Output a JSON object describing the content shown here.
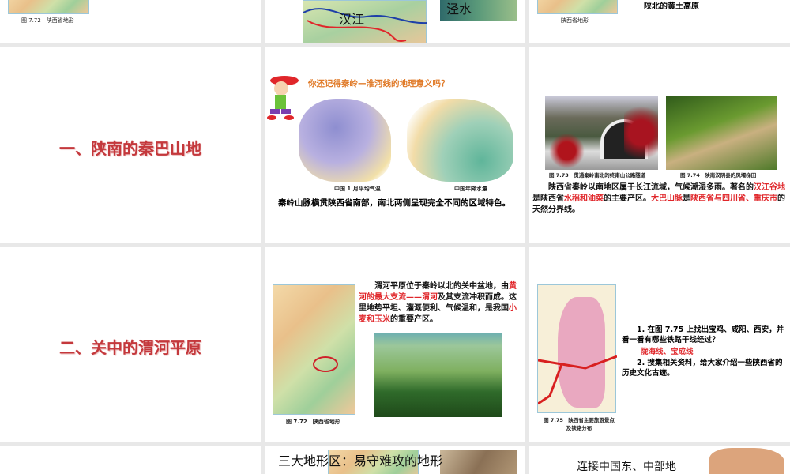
{
  "slides": {
    "s1": {
      "caption": "图 7.72　陕西省地形"
    },
    "s2": {
      "map_label": "汉江",
      "photo_label": "泾水"
    },
    "s3": {
      "caption": "陕西省地形",
      "text": "陕北的黄土高原"
    },
    "s4": {
      "title": "一、陕南的秦巴山地"
    },
    "s5": {
      "question": "你还记得秦岭—淮河线的地理意义吗？",
      "map1_caption": "中国 1 月平均气温",
      "map2_caption": "中国年降水量",
      "sentence": "秦岭山脉横贯陕西省南部，南北两侧呈现完全不同的区域特色。"
    },
    "s6": {
      "photo1_caption": "图 7.73　贯通秦岭南北的终南山公路隧道",
      "photo2_caption": "图 7.74　陕南汉阴县的凤堰梯田",
      "p": [
        "陕西省秦岭以南地区属于长江流域，气候潮湿多雨。著名的",
        "汉江谷地",
        "是陕西省",
        "水稻和油菜",
        "的主要产区。",
        "大巴山脉",
        "是",
        "陕西省与四川省、重庆市",
        "的天然分界线。"
      ]
    },
    "s7": {
      "title": "二、关中的渭河平原"
    },
    "s8": {
      "caption": "图 7.72　陕西省地形",
      "p": [
        "渭河平原位于秦岭以北的关中盆地，由",
        "黄河的最大支流——渭河",
        "及其支流冲积而成。这里地势平坦、灌溉便利、气候温和，是我国",
        "小麦和玉米",
        "的重要产区。"
      ]
    },
    "s9": {
      "caption": "图 7.75　陕西省主要旅游景点及铁路分布",
      "q1": "1. 在图 7.75 上找出宝鸡、咸阳、西安，并看一看有哪些铁路干线经过？",
      "a1": "陇海线、宝成线",
      "q2": "2. 搜集相关资料，给大家介绍一些陕西省的历史文化古迹。"
    },
    "s11": {
      "text": "三大地形区：易守难攻的地形"
    },
    "s12": {
      "text": "连接中国东、中部地"
    }
  },
  "colors": {
    "title_red": "#c4383c",
    "highlight_red": "#e0262a",
    "question_orange": "#e07a28"
  }
}
